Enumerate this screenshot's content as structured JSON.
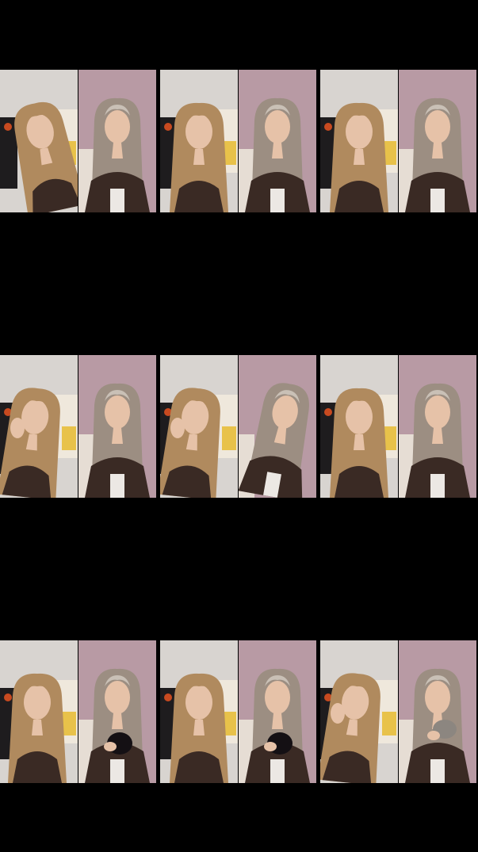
{
  "layout": {
    "rows": 3,
    "cols": 3,
    "split_screen": true
  },
  "colors": {
    "background": "#000000",
    "left_wall": "#d8d4d0",
    "right_wall": "#b89aa4",
    "hair_light": "#b08a5e",
    "hair_ash": "#9c8e82",
    "skin": "#e6c2a8",
    "top_dark": "#3a2a24",
    "kitten_black": "#141014",
    "kitten_gray": "#8c8680"
  },
  "tiles": [
    {
      "id": "r1c1",
      "left": {
        "scene": "room-blonde",
        "pose": "tilt"
      },
      "right": {
        "scene": "pink-ash",
        "pose": "front"
      }
    },
    {
      "id": "r1c2",
      "left": {
        "scene": "room-blonde",
        "pose": "talk"
      },
      "right": {
        "scene": "pink-ash",
        "pose": "smile"
      }
    },
    {
      "id": "r1c3",
      "left": {
        "scene": "room-blonde",
        "pose": "front"
      },
      "right": {
        "scene": "pink-ash",
        "pose": "front"
      }
    },
    {
      "id": "r2c1",
      "left": {
        "scene": "room-blonde",
        "pose": "hand"
      },
      "right": {
        "scene": "pink-ash",
        "pose": "smile"
      }
    },
    {
      "id": "r2c2",
      "left": {
        "scene": "room-blonde",
        "pose": "hand"
      },
      "right": {
        "scene": "pink-ash",
        "pose": "turn"
      }
    },
    {
      "id": "r2c3",
      "left": {
        "scene": "room-blonde",
        "pose": "front"
      },
      "right": {
        "scene": "pink-ash",
        "pose": "front"
      }
    },
    {
      "id": "r3c1",
      "left": {
        "scene": "room-blonde",
        "pose": "glance"
      },
      "right": {
        "scene": "pink-ash",
        "pose": "kitten-black"
      }
    },
    {
      "id": "r3c2",
      "left": {
        "scene": "room-blonde",
        "pose": "front"
      },
      "right": {
        "scene": "pink-ash",
        "pose": "kitten-black"
      }
    },
    {
      "id": "r3c3",
      "left": {
        "scene": "room-blonde",
        "pose": "hand"
      },
      "right": {
        "scene": "pink-ash",
        "pose": "kitten-gray"
      }
    }
  ]
}
